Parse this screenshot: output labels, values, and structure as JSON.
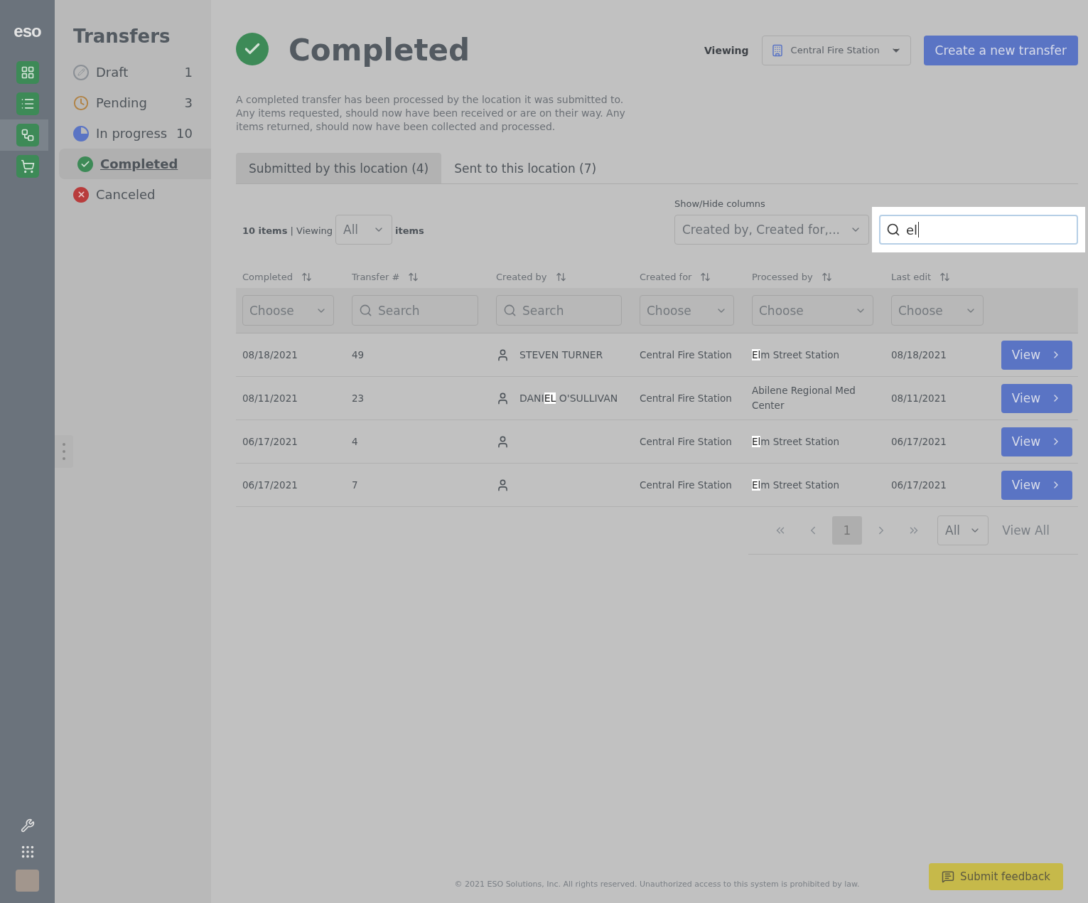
{
  "rail": {
    "logo": "eso",
    "items": [
      {
        "kind": "blocks",
        "selected": false
      },
      {
        "kind": "list",
        "selected": false
      },
      {
        "kind": "transfer",
        "selected": true
      },
      {
        "kind": "cart",
        "selected": false
      }
    ],
    "bottom": [
      {
        "kind": "wrench"
      },
      {
        "kind": "apps"
      },
      {
        "kind": "avatar"
      }
    ]
  },
  "sidebar": {
    "title": "Transfers",
    "items": [
      {
        "label": "Draft",
        "count": "1",
        "kind": "draft",
        "selected": false
      },
      {
        "label": "Pending",
        "count": "3",
        "kind": "pending",
        "selected": false
      },
      {
        "label": "In progress",
        "count": "10",
        "kind": "progress",
        "selected": false
      },
      {
        "label": "Completed",
        "kind": "completed",
        "selected": true
      },
      {
        "label": "Canceled",
        "kind": "canceled",
        "selected": false
      }
    ]
  },
  "header": {
    "title": "Completed",
    "viewing_label": "Viewing",
    "location": "Central Fire Station",
    "create_button": "Create a new transfer"
  },
  "description": "A completed transfer has been processed by the location it was submitted to. Any items requested, should now have been received or are on their way. Any items returned, should now have been collected and processed.",
  "tabs": [
    {
      "label": "Submitted by this location (4)",
      "selected": true
    },
    {
      "label": "Sent to this location (7)",
      "selected": false
    }
  ],
  "toolbar": {
    "count_text": "**10 items** | Viewing",
    "per_page": "All",
    "items_label": "items",
    "columns_label": "Show/Hide columns",
    "columns_select": "Created by, Created for,...",
    "search_value": "el"
  },
  "table": {
    "columns": [
      {
        "label": "Completed",
        "filter": {
          "kind": "select",
          "placeholder": "Choose"
        }
      },
      {
        "label": "Transfer #",
        "filter": {
          "kind": "search",
          "placeholder": "Search"
        }
      },
      {
        "label": "Created by",
        "filter": {
          "kind": "search",
          "placeholder": "Search"
        }
      },
      {
        "label": "Created for",
        "filter": {
          "kind": "select",
          "placeholder": "Choose"
        }
      },
      {
        "label": "Processed by",
        "filter": {
          "kind": "select",
          "placeholder": "Choose"
        }
      },
      {
        "label": "Last edit",
        "filter": {
          "kind": "select",
          "placeholder": "Choose"
        }
      }
    ],
    "rows": [
      {
        "completed": "08/18/2021",
        "transfer": "49",
        "created_by": [
          {
            "text": "STEVEN TURNER",
            "highlighted": false
          }
        ],
        "created_for": "Central Fire Station",
        "processed_by": [
          {
            "text": "El",
            "highlighted": true
          },
          {
            "text": "m Street Station",
            "highlighted": false
          }
        ],
        "last_edit": "08/18/2021",
        "action": "View"
      },
      {
        "completed": "08/11/2021",
        "transfer": "23",
        "created_by": [
          {
            "text": "DANI",
            "highlighted": false
          },
          {
            "text": "EL",
            "highlighted": true
          },
          {
            "text": " O'SULLIVAN",
            "highlighted": false
          }
        ],
        "created_for": "Central Fire Station",
        "processed_by": [
          {
            "text": "Abilene Regional Med Center",
            "highlighted": false
          }
        ],
        "last_edit": "08/11/2021",
        "action": "View"
      },
      {
        "completed": "06/17/2021",
        "transfer": "4",
        "created_for": "Central Fire Station",
        "processed_by": [
          {
            "text": "El",
            "highlighted": true
          },
          {
            "text": "m Street Station",
            "highlighted": false
          }
        ],
        "last_edit": "06/17/2021",
        "action": "View"
      },
      {
        "completed": "06/17/2021",
        "transfer": "7",
        "created_for": "Central Fire Station",
        "processed_by": [
          {
            "text": "El",
            "highlighted": true
          },
          {
            "text": "m Street Station",
            "highlighted": false
          }
        ],
        "last_edit": "06/17/2021",
        "action": "View"
      }
    ]
  },
  "pagination": {
    "page": "1",
    "per_page": "All",
    "view_all": "View All"
  },
  "footer": "© 2021 ESO Solutions, Inc. All rights reserved. Unauthorized access to this system is prohibited by law.",
  "feedback_button": "Submit feedback"
}
